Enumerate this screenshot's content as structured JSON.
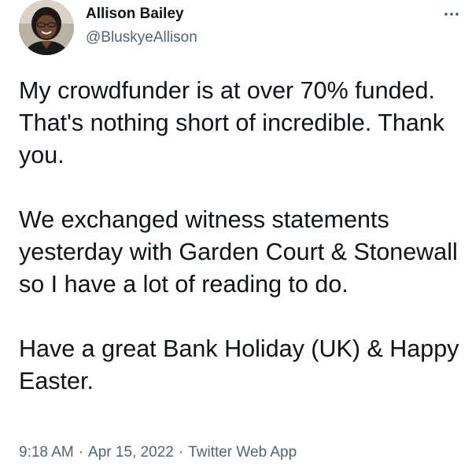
{
  "tweet": {
    "author_name": "Allison Bailey",
    "author_handle": "@BluskyeAllison",
    "more_icon": "more-horizontal-icon",
    "paragraphs": [
      "My crowdfunder is at over 70% funded. That's nothing short of incredible.  Thank you.",
      "We exchanged witness statements yesterday with Garden Court & Stonewall so I have a lot of reading to do.",
      "Have a great Bank Holiday (UK) & Happy Easter."
    ],
    "time": "9:18 AM",
    "date": "Apr 15, 2022",
    "separator": "·",
    "source": "Twitter Web App"
  },
  "colors": {
    "text": "#0f1419",
    "secondary": "#536471",
    "background": "#ffffff"
  }
}
